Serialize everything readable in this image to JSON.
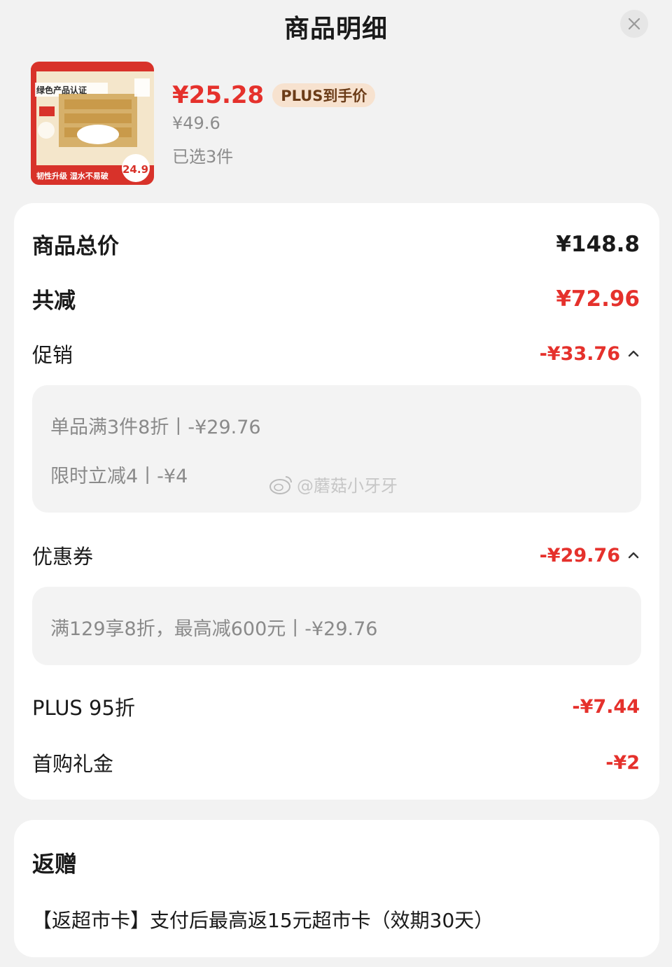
{
  "header": {
    "title": "商品明细",
    "close_icon": "close-icon"
  },
  "product": {
    "image_icon": "tissue-pack-product-image",
    "image_text": {
      "cert": "绿色产品认证",
      "promo": "韧性升级 湿水不易破",
      "tag_price": "24.9"
    },
    "deal_price": "¥25.28",
    "plus_badge": "PLUS到手价",
    "original_price": "¥49.6",
    "selected": "已选3件"
  },
  "summary": {
    "total_label": "商品总价",
    "total_value": "¥148.8",
    "reduce_label": "共减",
    "reduce_value": "¥72.96",
    "promo_label": "促销",
    "promo_value": "-¥33.76",
    "promo_items": [
      "单品满3件8折丨-¥29.76",
      "限时立减4丨-¥4"
    ],
    "coupon_label": "优惠券",
    "coupon_value": "-¥29.76",
    "coupon_items": [
      "满129享8折，最高减600元丨-¥29.76"
    ],
    "plus_label": "PLUS 95折",
    "plus_value": "-¥7.44",
    "first_buy_label": "首购礼金",
    "first_buy_value": "-¥2"
  },
  "rebate": {
    "title": "返赠",
    "text": "【返超市卡】支付后最高返15元超市卡（效期30天）"
  },
  "watermark": {
    "text": "@蘑菇小牙牙",
    "icon": "weibo-icon"
  },
  "colors": {
    "accent_red": "#e5312c",
    "plus_badge_bg": "#f7e2cf",
    "card_bg": "#ffffff",
    "page_bg": "#f2f2f2"
  }
}
